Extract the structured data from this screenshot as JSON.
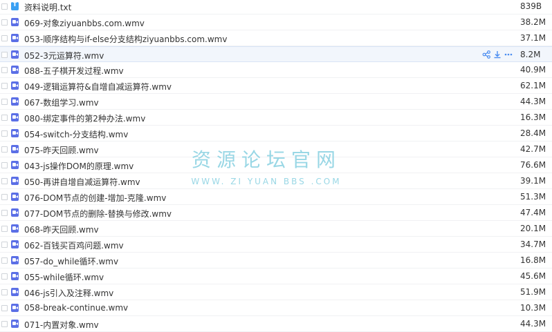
{
  "files": [
    {
      "name": "资料说明.txt",
      "size": "839B",
      "type": "txt"
    },
    {
      "name": "069-对象ziyuanbbs.com.wmv",
      "size": "38.2M",
      "type": "video"
    },
    {
      "name": "053-顺序结构与if-else分支结构ziyuanbbs.com.wmv",
      "size": "37.1M",
      "type": "video"
    },
    {
      "name": "052-3元运算符.wmv",
      "size": "8.2M",
      "type": "video",
      "hover": true
    },
    {
      "name": "088-五子棋开发过程.wmv",
      "size": "40.9M",
      "type": "video"
    },
    {
      "name": "049-逻辑运算符&自增自减运算符.wmv",
      "size": "62.1M",
      "type": "video"
    },
    {
      "name": "067-数组学习.wmv",
      "size": "44.3M",
      "type": "video"
    },
    {
      "name": "080-绑定事件的第2种办法.wmv",
      "size": "16.3M",
      "type": "video"
    },
    {
      "name": "054-switch-分支结构.wmv",
      "size": "28.4M",
      "type": "video"
    },
    {
      "name": "075-昨天回顾.wmv",
      "size": "42.7M",
      "type": "video"
    },
    {
      "name": "043-js操作DOM的原理.wmv",
      "size": "76.6M",
      "type": "video"
    },
    {
      "name": "050-再讲自增自减运算符.wmv",
      "size": "39.1M",
      "type": "video"
    },
    {
      "name": "076-DOM节点的创建-增加-克隆.wmv",
      "size": "51.3M",
      "type": "video"
    },
    {
      "name": "077-DOM节点的删除-替换与修改.wmv",
      "size": "47.4M",
      "type": "video"
    },
    {
      "name": "068-昨天回顾.wmv",
      "size": "20.1M",
      "type": "video"
    },
    {
      "name": "062-百钱买百鸡问题.wmv",
      "size": "34.7M",
      "type": "video"
    },
    {
      "name": "057-do_while循环.wmv",
      "size": "16.8M",
      "type": "video"
    },
    {
      "name": "055-while循环.wmv",
      "size": "45.6M",
      "type": "video"
    },
    {
      "name": "046-js引入及注释.wmv",
      "size": "51.9M",
      "type": "video"
    },
    {
      "name": "058-break-continue.wmv",
      "size": "10.3M",
      "type": "video"
    },
    {
      "name": "071-内置对象.wmv",
      "size": "44.3M",
      "type": "video"
    }
  ],
  "row_actions": [
    "share-icon",
    "download-icon",
    "more-icon"
  ],
  "watermark": {
    "title": "资源论坛官网",
    "subtitle": "WWW. ZI YUAN BBS .COM"
  },
  "colors": {
    "video_icon": "#5b6fe6",
    "txt_icon": "#3aa0f3",
    "action_icon": "#4a8cf0",
    "hover_row": "#f2f6fc",
    "watermark": "#8fd3e3"
  }
}
